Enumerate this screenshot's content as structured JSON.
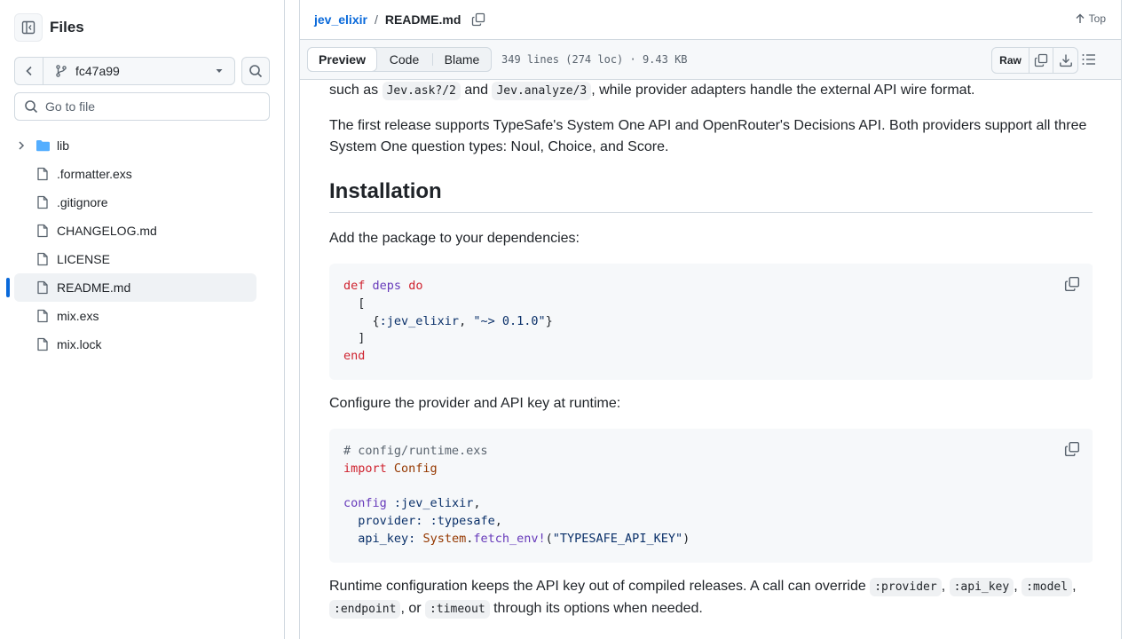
{
  "sidebar": {
    "title": "Files",
    "branch": "fc47a99",
    "goto_placeholder": "Go to file",
    "items": [
      {
        "label": "lib",
        "type": "folder"
      },
      {
        "label": ".formatter.exs",
        "type": "file"
      },
      {
        "label": ".gitignore",
        "type": "file"
      },
      {
        "label": "CHANGELOG.md",
        "type": "file"
      },
      {
        "label": "LICENSE",
        "type": "file"
      },
      {
        "label": "README.md",
        "type": "file",
        "active": true
      },
      {
        "label": "mix.exs",
        "type": "file"
      },
      {
        "label": "mix.lock",
        "type": "file"
      }
    ]
  },
  "header": {
    "repo": "jev_elixir",
    "separator": "/",
    "file": "README.md",
    "top_label": "Top"
  },
  "toolbar": {
    "tabs": [
      "Preview",
      "Code",
      "Blame"
    ],
    "selected_tab": "Preview",
    "file_info": "349 lines (274 loc) · 9.43 KB",
    "raw_label": "Raw"
  },
  "readme": {
    "p1_pre": "such as",
    "p1_code1": "Jev.ask?/2",
    "p1_and": "and",
    "p1_code2": "Jev.analyze/3",
    "p1_post": ", while provider adapters handle the external API wire format.",
    "p2": "The first release supports TypeSafe's System One API and OpenRouter's Decisions API. Both providers support all three System One question types: Noul, Choice, and Score.",
    "h2": "Installation",
    "p3": "Add the package to your dependencies:",
    "p4": "Configure the provider and API key at runtime:",
    "p5_pre": "Runtime configuration keeps the API key out of compiled releases. A call can override",
    "p5_code1": ":provider",
    "p5_sep1": ",",
    "p5_code2": ":api_key",
    "p5_sep2": ",",
    "p5_code3": ":model",
    "p5_sep3": ",",
    "p5_code4": ":endpoint",
    "p5_or": ", or",
    "p5_code5": ":timeout",
    "p5_post": "through its options when needed.",
    "code1": {
      "def": "def",
      "deps": "deps",
      "do": "do",
      "open": "[",
      "tuple_open": "{",
      "atom": ":jev_elixir",
      "comma": ", ",
      "version": "\"~> 0.1.0\"",
      "tuple_close": "}",
      "close": "]",
      "end": "end"
    },
    "code2": {
      "comment": "# config/runtime.exs",
      "import": "import",
      "config_mod": "Config",
      "config_kw": "config",
      "app_atom": ":jev_elixir",
      "comma": ",",
      "provider_key": "provider:",
      "provider_val": ":typesafe",
      "api_key_key": "api_key:",
      "system_mod": "System",
      "dot": ".",
      "fetch_env": "fetch_env!",
      "paren_open": "(",
      "env_name": "\"TYPESAFE_API_KEY\"",
      "paren_close": ")"
    }
  }
}
